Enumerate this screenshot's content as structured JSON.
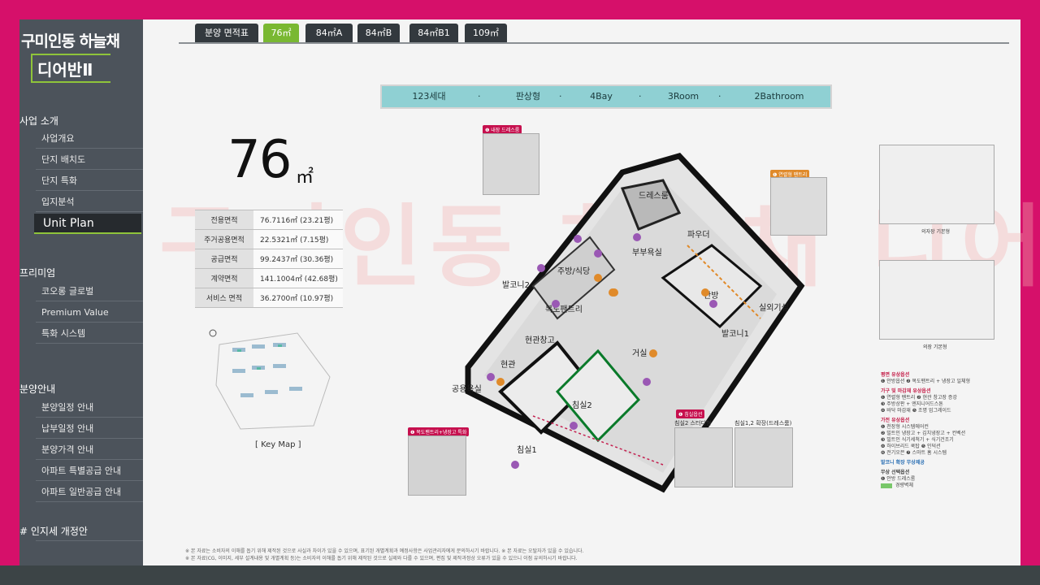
{
  "sidebar": {
    "brand_line1": "구미인동 하늘채",
    "brand_line2": "디어반Ⅱ",
    "sections": [
      {
        "label": "사업 소개",
        "items": [
          "사업개요",
          "단지 배치도",
          "단지 특화",
          "입지분석",
          "Unit Plan"
        ]
      },
      {
        "label": "프리미엄",
        "items": [
          "코오롱 글로벌",
          "Premium Value",
          "특화 시스템"
        ]
      },
      {
        "label": "분양안내",
        "items": [
          "분양일정 안내",
          "납부일정 안내",
          "분양가격 안내",
          "아파트 특별공급 안내",
          "아파트 일반공급 안내"
        ]
      },
      {
        "label": "# 인지세 개정안",
        "items": []
      }
    ],
    "active_item": "Unit Plan"
  },
  "tabs": [
    {
      "label": "분양 면적표"
    },
    {
      "label": "76㎡"
    },
    {
      "label": "84㎡A"
    },
    {
      "label": "84㎡B"
    },
    {
      "label": "84㎡B1"
    },
    {
      "label": "109㎡"
    }
  ],
  "active_tab": "76㎡",
  "spec_bar": {
    "items": [
      "123세대",
      "판상형",
      "4Bay",
      "3Room",
      "2Bathroom"
    ],
    "separator": "·"
  },
  "unit": {
    "size": "76",
    "unit_symbol": "㎡"
  },
  "area_table": [
    {
      "label": "전용면적",
      "value": "76.7116㎡ (23.21평)"
    },
    {
      "label": "주거공용면적",
      "value": "22.5321㎡ (7.15평)"
    },
    {
      "label": "공급면적",
      "value": "99.2437㎡ (30.36평)"
    },
    {
      "label": "계약면적",
      "value": "141.1004㎡ (42.68평)"
    },
    {
      "label": "서비스 면적",
      "value": "36.2700㎡ (10.97평)"
    }
  ],
  "key_map_label": "[ Key  Map ]",
  "rooms": {
    "balcony2": "발코니2",
    "kitchen": "주방/식당",
    "pantry": "드레스룸",
    "dress": "드레스룸",
    "master_bath": "부부욕실",
    "powder": "파우더",
    "master": "안방",
    "living": "거실",
    "entrance": "현관",
    "shoes": "현관창고",
    "multi": "복도팬트리",
    "bath": "공용욕실",
    "bed2": "침실2",
    "bed1": "침실1",
    "balcony1": "발코니1",
    "outdoor": "실외기실"
  },
  "callouts": {
    "top_left": "❶ 내장 드레스룸",
    "right": "❶ 연렬형 팬트리",
    "bottom_left": "❶ 복도팬트리+냉장고 특화",
    "option": "❶ 침실옵션"
  },
  "thumbs": {
    "t1": "침실2 스터디형",
    "t2": "침실1,2 확장(드레스룸)",
    "plan1": "의자장 기본형",
    "plan2": "의장 기본형"
  },
  "legend": {
    "h1": "평면 유상옵션",
    "l1": "❶ 안방옵션 ❷ 복도팬트리 + 냉장고 일체형",
    "h2": "가구 및 마감재 유상옵션",
    "l2a": "❶ 연렬형 팬트리 ❷ 현관 창고장 증강",
    "l2b": "❸ 주방상판 + 엔지니어드스톤",
    "l2c": "❹ 바닥 마감재 ❺ 조명 업그레이드",
    "h3": "가전 유상옵션",
    "l3a": "❶ 천장형 시스템에어컨",
    "l3b": "❷ 빌트인 냉장고 + 김치냉장고 + 컨벡션",
    "l3c": "❸ 빌트인 식기세척기 + 식기건조기",
    "l3d": "❹ 하이브리드 쿡탑 ❺ 인덕션",
    "l3e": "❻ 전기오븐 ❼ 스마트 홈 시스템",
    "h4": "발코니 확장 무상제공",
    "h5": "무상 선택옵션",
    "l5": "❶ 안방 드레스룸",
    "l6": "경량벽체"
  },
  "watermark": "구미인동 하늘채 디어반2차",
  "footer": {
    "line1": "※ 본 자료는 소비자의 이해를 돕기 위해 제작된 것으로 사실과 차이가 있을 수 있으며, 표기된 개별계획과 예정사항은 사업관리자에게 문의하시기 바랍니다.   ※ 본 자료는 오탈자가 있을 수 있습니다.",
    "line2": "※ 본 자료(CG, 이미지, 세부 설계내용 및 개별계획 등)는 소비자의 이해를 돕기 위해 제작된 것으로 실제와 다를 수 있으며, 편집 및 제작과정상 오류가 있을 수 있으니 이점 유의하시기 바랍니다."
  },
  "colors": {
    "frame": "#d6106a",
    "sidebar": "#4c535b",
    "tab": "#33393e",
    "tab_active": "#79b832",
    "spec_bar": "#8fd0d3",
    "accent_green": "#8fc43a"
  }
}
